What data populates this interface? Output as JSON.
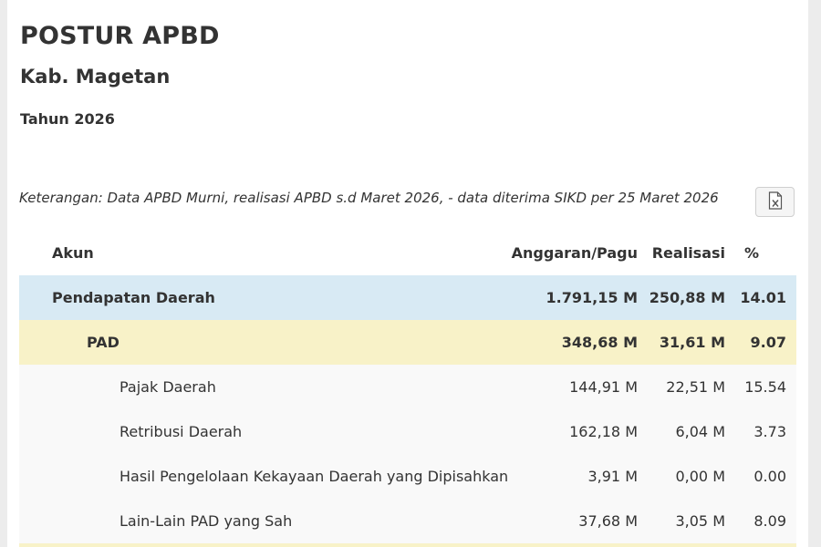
{
  "page": {
    "title": "POSTUR APBD",
    "region": "Kab. Magetan",
    "year": "Tahun 2026",
    "note": "Keterangan: Data APBD Murni, realisasi APBD s.d Maret 2026, - data diterima SIKD per 25 Maret 2026"
  },
  "export": {
    "icon": "excel-file-icon"
  },
  "table": {
    "headers": {
      "akun": "Akun",
      "anggaran": "Anggaran/Pagu",
      "realisasi": "Realisasi",
      "persen": "%"
    },
    "rows": [
      {
        "akun": "Pendapatan Daerah",
        "anggaran": "1.791,15 M",
        "realisasi": "250,88 M",
        "persen": "14.01",
        "level": 0
      },
      {
        "akun": "PAD",
        "anggaran": "348,68 M",
        "realisasi": "31,61 M",
        "persen": "9.07",
        "level": 1
      },
      {
        "akun": "Pajak Daerah",
        "anggaran": "144,91 M",
        "realisasi": "22,51 M",
        "persen": "15.54",
        "level": 2
      },
      {
        "akun": "Retribusi Daerah",
        "anggaran": "162,18 M",
        "realisasi": "6,04 M",
        "persen": "3.73",
        "level": 2
      },
      {
        "akun": "Hasil Pengelolaan Kekayaan Daerah yang Dipisahkan",
        "anggaran": "3,91 M",
        "realisasi": "0,00 M",
        "persen": "0.00",
        "level": 2
      },
      {
        "akun": "Lain-Lain PAD yang Sah",
        "anggaran": "37,68 M",
        "realisasi": "3,05 M",
        "persen": "8.09",
        "level": 2
      }
    ]
  },
  "colors": {
    "level0_bg": "#d8eaf4",
    "level1_bg": "#f8f2c8",
    "level2_bg": "#f9f9f9",
    "text": "#333333"
  }
}
